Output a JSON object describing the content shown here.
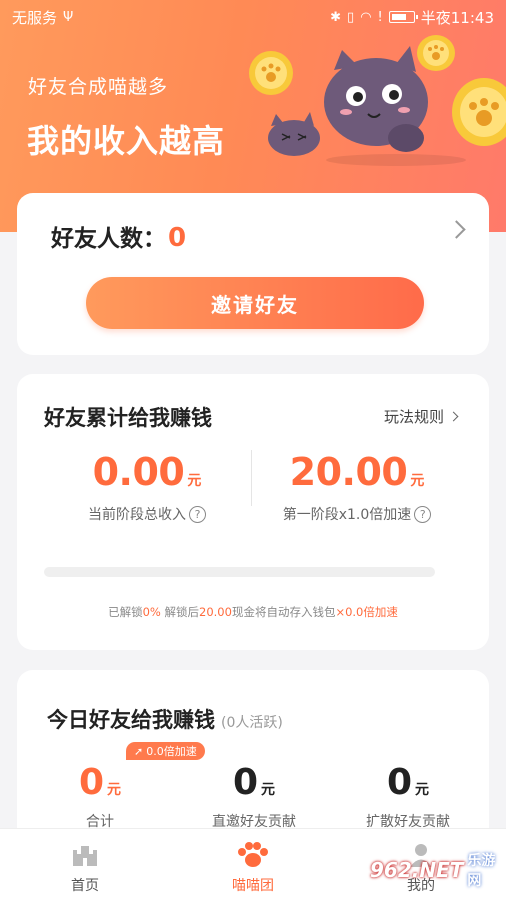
{
  "status_bar": {
    "carrier": "无服务",
    "time": "半夜11:43"
  },
  "hero": {
    "subtitle": "好友合成喵越多",
    "title": "我的收入越高"
  },
  "friends": {
    "label": "好友人数：",
    "count": "0",
    "invite_button": "邀请好友"
  },
  "cumulative": {
    "title": "好友累计给我赚钱",
    "rules_link": "玩法规则",
    "stats": [
      {
        "value": "0.00",
        "unit": "元",
        "label": "当前阶段总收入"
      },
      {
        "value": "20.00",
        "unit": "元",
        "label": "第一阶段x1.0倍加速"
      }
    ],
    "progress": 0,
    "note_prefix": "已解锁",
    "note_percent": "0%",
    "note_mid": " 解锁后",
    "note_amount": "20.00",
    "note_mid2": "现金将自动存入钱包",
    "note_bonus": "×0.0倍加速"
  },
  "today": {
    "title": "今日好友给我赚钱",
    "subtitle": "(0人活跃)",
    "badge": "0.0倍加速",
    "stats": [
      {
        "value": "0",
        "unit": "元",
        "label": "合计",
        "color": "#ff6b3d"
      },
      {
        "value": "0",
        "unit": "元",
        "label": "直邀好友贡献",
        "color": "#222222"
      },
      {
        "value": "0",
        "unit": "元",
        "label": "扩散好友贡献",
        "color": "#222222"
      }
    ]
  },
  "nav": {
    "items": [
      {
        "label": "首页",
        "icon": "castle-icon"
      },
      {
        "label": "喵喵团",
        "icon": "paw-icon"
      },
      {
        "label": "我的",
        "icon": "user-icon"
      }
    ]
  },
  "watermark": {
    "brand": "962.NET",
    "sub": "乐游网"
  },
  "colors": {
    "accent": "#ff6b3d",
    "hero_start": "#ff9a5c",
    "hero_end": "#ff7a6a"
  }
}
